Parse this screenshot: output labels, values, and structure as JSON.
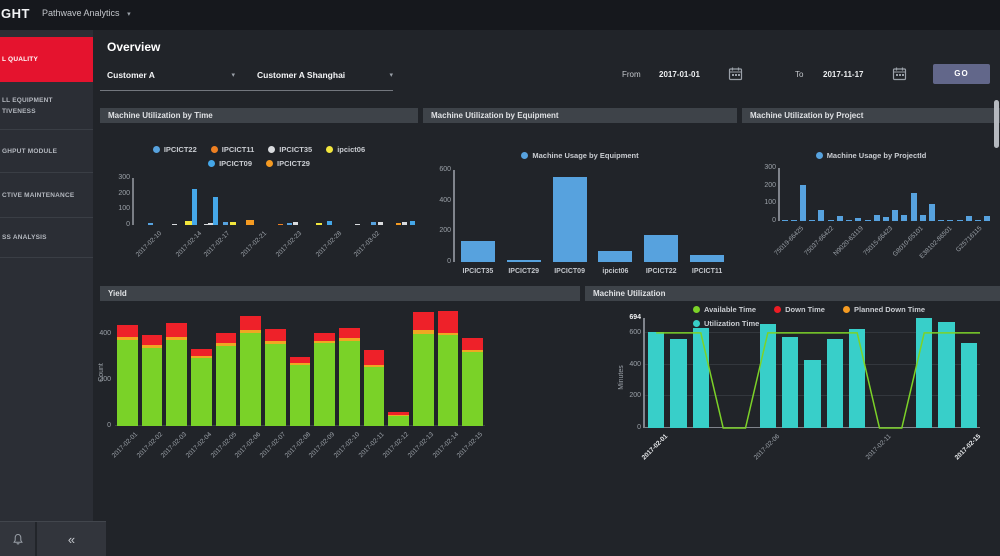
{
  "topbar": {
    "logo": "GHT",
    "app_menu": "Pathwave Analytics",
    "caret_icon": "▾"
  },
  "sidebar": {
    "items": [
      {
        "lines": [
          "L QUALITY"
        ],
        "active": true
      },
      {
        "lines": [
          "LL EQUIPMENT",
          "TIVENESS"
        ]
      },
      {
        "lines": [
          "GHPUT MODULE"
        ]
      },
      {
        "lines": [
          "CTIVE MAINTENANCE"
        ]
      },
      {
        "lines": [
          "SS ANALYSIS"
        ]
      }
    ],
    "footer": {
      "bell_icon": "bell",
      "collapse_label": "«"
    }
  },
  "header": {
    "title": "Overview",
    "customer_dropdown": "Customer A",
    "site_dropdown": "Customer A Shanghai",
    "from_label": "From",
    "from_date": "2017-01-01",
    "to_label": "To",
    "to_date": "2017-11-17",
    "go_label": "GO"
  },
  "panels": {
    "by_time": {
      "title": "Machine Utilization by Time"
    },
    "by_equipment": {
      "title": "Machine Utilization by Equipment"
    },
    "by_project": {
      "title": "Machine Utilization by Project"
    },
    "yield": {
      "title": "Yield"
    },
    "machine_utilization": {
      "title": "Machine Utilization"
    }
  },
  "chart_data": [
    {
      "id": "by_time",
      "type": "bar",
      "title": "Machine Utilization by Time",
      "legend": [
        "IPCICT22",
        "IPCICT11",
        "IPCICT35",
        "ipcict06",
        "IPCICT09",
        "IPCICT29"
      ],
      "series_colors": {
        "IPCICT22": "#57a2de",
        "IPCICT11": "#ee8022",
        "IPCICT35": "#d9dbde",
        "ipcict06": "#f2e63d",
        "IPCICT09": "#45a7e8",
        "IPCICT29": "#f59b22"
      },
      "ylim": [
        0,
        300
      ],
      "yticks": [
        0,
        100,
        200,
        300
      ],
      "xticks": [
        {
          "label": "2017-02-10",
          "f": 0.057
        },
        {
          "label": "2017-02-14",
          "f": 0.199
        },
        {
          "label": "2017-02-17",
          "f": 0.299
        },
        {
          "label": "2017-02-21",
          "f": 0.43
        },
        {
          "label": "2017-02-23",
          "f": 0.555
        },
        {
          "label": "2017-02-28",
          "f": 0.697
        },
        {
          "label": "2017-03-02",
          "f": 0.833
        }
      ],
      "bars": [
        {
          "x": 0.05,
          "s": "IPCICT22",
          "v": 10
        },
        {
          "x": 0.135,
          "s": "IPCICT35",
          "v": 6
        },
        {
          "x": 0.183,
          "s": "ipcict06",
          "v": 25,
          "w": 7
        },
        {
          "x": 0.205,
          "s": "IPCICT09",
          "v": 230
        },
        {
          "x": 0.248,
          "s": "IPCICT35",
          "v": 8
        },
        {
          "x": 0.263,
          "s": "IPCICT35",
          "v": 15
        },
        {
          "x": 0.28,
          "s": "IPCICT09",
          "v": 180
        },
        {
          "x": 0.315,
          "s": "IPCICT22",
          "v": 18
        },
        {
          "x": 0.343,
          "s": "ipcict06",
          "v": 20,
          "w": 6
        },
        {
          "x": 0.398,
          "s": "IPCICT29",
          "v": 30,
          "w": 8
        },
        {
          "x": 0.512,
          "s": "IPCICT11",
          "v": 6
        },
        {
          "x": 0.545,
          "s": "IPCICT22",
          "v": 15
        },
        {
          "x": 0.567,
          "s": "IPCICT35",
          "v": 22
        },
        {
          "x": 0.648,
          "s": "ipcict06",
          "v": 12,
          "w": 6
        },
        {
          "x": 0.685,
          "s": "IPCICT09",
          "v": 28
        },
        {
          "x": 0.785,
          "s": "IPCICT35",
          "v": 5
        },
        {
          "x": 0.845,
          "s": "IPCICT22",
          "v": 18
        },
        {
          "x": 0.868,
          "s": "IPCICT35",
          "v": 22
        },
        {
          "x": 0.933,
          "s": "IPCICT29",
          "v": 10
        },
        {
          "x": 0.955,
          "s": "IPCICT35",
          "v": 18
        },
        {
          "x": 0.982,
          "s": "IPCICT09",
          "v": 28
        }
      ]
    },
    {
      "id": "by_equipment",
      "type": "bar",
      "title": "Machine Utilization by Equipment",
      "legend": [
        "Machine Usage by Equipment"
      ],
      "legend_color": "#57a2de",
      "bar_color": "#57a2de",
      "categories": [
        "IPCICT35",
        "IPCICT29",
        "IPCICT09",
        "ipcict06",
        "IPCICT22",
        "IPCICT11"
      ],
      "values": [
        140,
        15,
        555,
        75,
        175,
        45
      ],
      "ylim": [
        0,
        600
      ],
      "yticks": [
        0,
        200,
        400,
        600
      ]
    },
    {
      "id": "by_project",
      "type": "bar",
      "title": "Machine Utilization by Project",
      "legend": [
        "Machine Usage by ProjectId"
      ],
      "legend_color": "#57a2de",
      "bar_color": "#57a2de",
      "values": [
        3,
        3,
        205,
        3,
        60,
        3,
        28,
        3,
        20,
        3,
        35,
        25,
        60,
        35,
        160,
        35,
        95,
        3,
        3,
        3,
        30,
        3,
        30
      ],
      "ylim": [
        0,
        300
      ],
      "yticks": [
        0,
        100,
        200,
        300
      ],
      "xticks": [
        {
          "label": "75019-66425",
          "f": 0.06
        },
        {
          "label": "75037-66422",
          "f": 0.2
        },
        {
          "label": "N9020-63119",
          "f": 0.34
        },
        {
          "label": "75015-66423",
          "f": 0.48
        },
        {
          "label": "G8010-65101",
          "f": 0.62
        },
        {
          "label": "E38102-86501",
          "f": 0.76
        },
        {
          "label": "G25716115",
          "f": 0.9
        }
      ]
    },
    {
      "id": "yield",
      "type": "stacked-bar",
      "title": "Yield",
      "ylabel": "Count",
      "categories": [
        "2017-02-01",
        "2017-02-02",
        "2017-02-03",
        "2017-02-04",
        "2017-02-05",
        "2017-02-06",
        "2017-02-07",
        "2017-02-08",
        "2017-02-09",
        "2017-02-10",
        "2017-02-11",
        "2017-02-12",
        "2017-02-13",
        "2017-02-14",
        "2017-02-15"
      ],
      "series": [
        {
          "name": "green",
          "color": "#7ad228",
          "values": [
            375,
            340,
            375,
            295,
            348,
            405,
            355,
            265,
            358,
            370,
            255,
            45,
            400,
            395,
            320
          ]
        },
        {
          "name": "orange",
          "color": "#f0a722",
          "values": [
            10,
            10,
            10,
            8,
            10,
            12,
            12,
            8,
            12,
            10,
            10,
            5,
            15,
            10,
            10
          ]
        },
        {
          "name": "red",
          "color": "#ee2129",
          "values": [
            55,
            46,
            61,
            29,
            46,
            59,
            54,
            26,
            33,
            46,
            63,
            10,
            80,
            95,
            53
          ]
        }
      ],
      "ylim": [
        0,
        520
      ],
      "yticks": [
        0,
        200,
        400
      ]
    },
    {
      "id": "machine_utilization",
      "type": "bar+line",
      "title": "Machine Utilization",
      "ylabel": "Minutes",
      "legend": [
        {
          "label": "Available Time",
          "color": "#7cd228"
        },
        {
          "label": "Down Time",
          "color": "#ed1c24"
        },
        {
          "label": "Planned Down Time",
          "color": "#f59b22"
        },
        {
          "label": "Utilization Time",
          "color": "#38cfc9"
        }
      ],
      "bar_color": "#38cfc9",
      "line_color": "#7cd228",
      "categories": [
        "2017-02-01",
        "2017-02-02",
        "2017-02-03",
        "2017-02-04",
        "2017-02-05",
        "2017-02-06",
        "2017-02-07",
        "2017-02-08",
        "2017-02-09",
        "2017-02-10",
        "2017-02-11",
        "2017-02-12",
        "2017-02-13",
        "2017-02-14",
        "2017-02-15"
      ],
      "bars": [
        605,
        563,
        630,
        0,
        0,
        655,
        573,
        428,
        563,
        622,
        0,
        0,
        694,
        672,
        538
      ],
      "line": [
        600,
        600,
        600,
        0,
        0,
        600,
        600,
        600,
        600,
        600,
        0,
        0,
        600,
        600,
        600
      ],
      "ylim": [
        0,
        694
      ],
      "yticks": [
        0,
        200,
        400,
        600,
        694
      ],
      "ytick_emph": 694,
      "xticks": [
        {
          "i": 0,
          "label": "2017-02-01",
          "bold": true
        },
        {
          "i": 5,
          "label": "2017-02-06",
          "bold": false
        },
        {
          "i": 10,
          "label": "2017-02-11",
          "bold": false
        },
        {
          "i": 14,
          "label": "2017-02-15",
          "bold": true
        }
      ]
    }
  ]
}
